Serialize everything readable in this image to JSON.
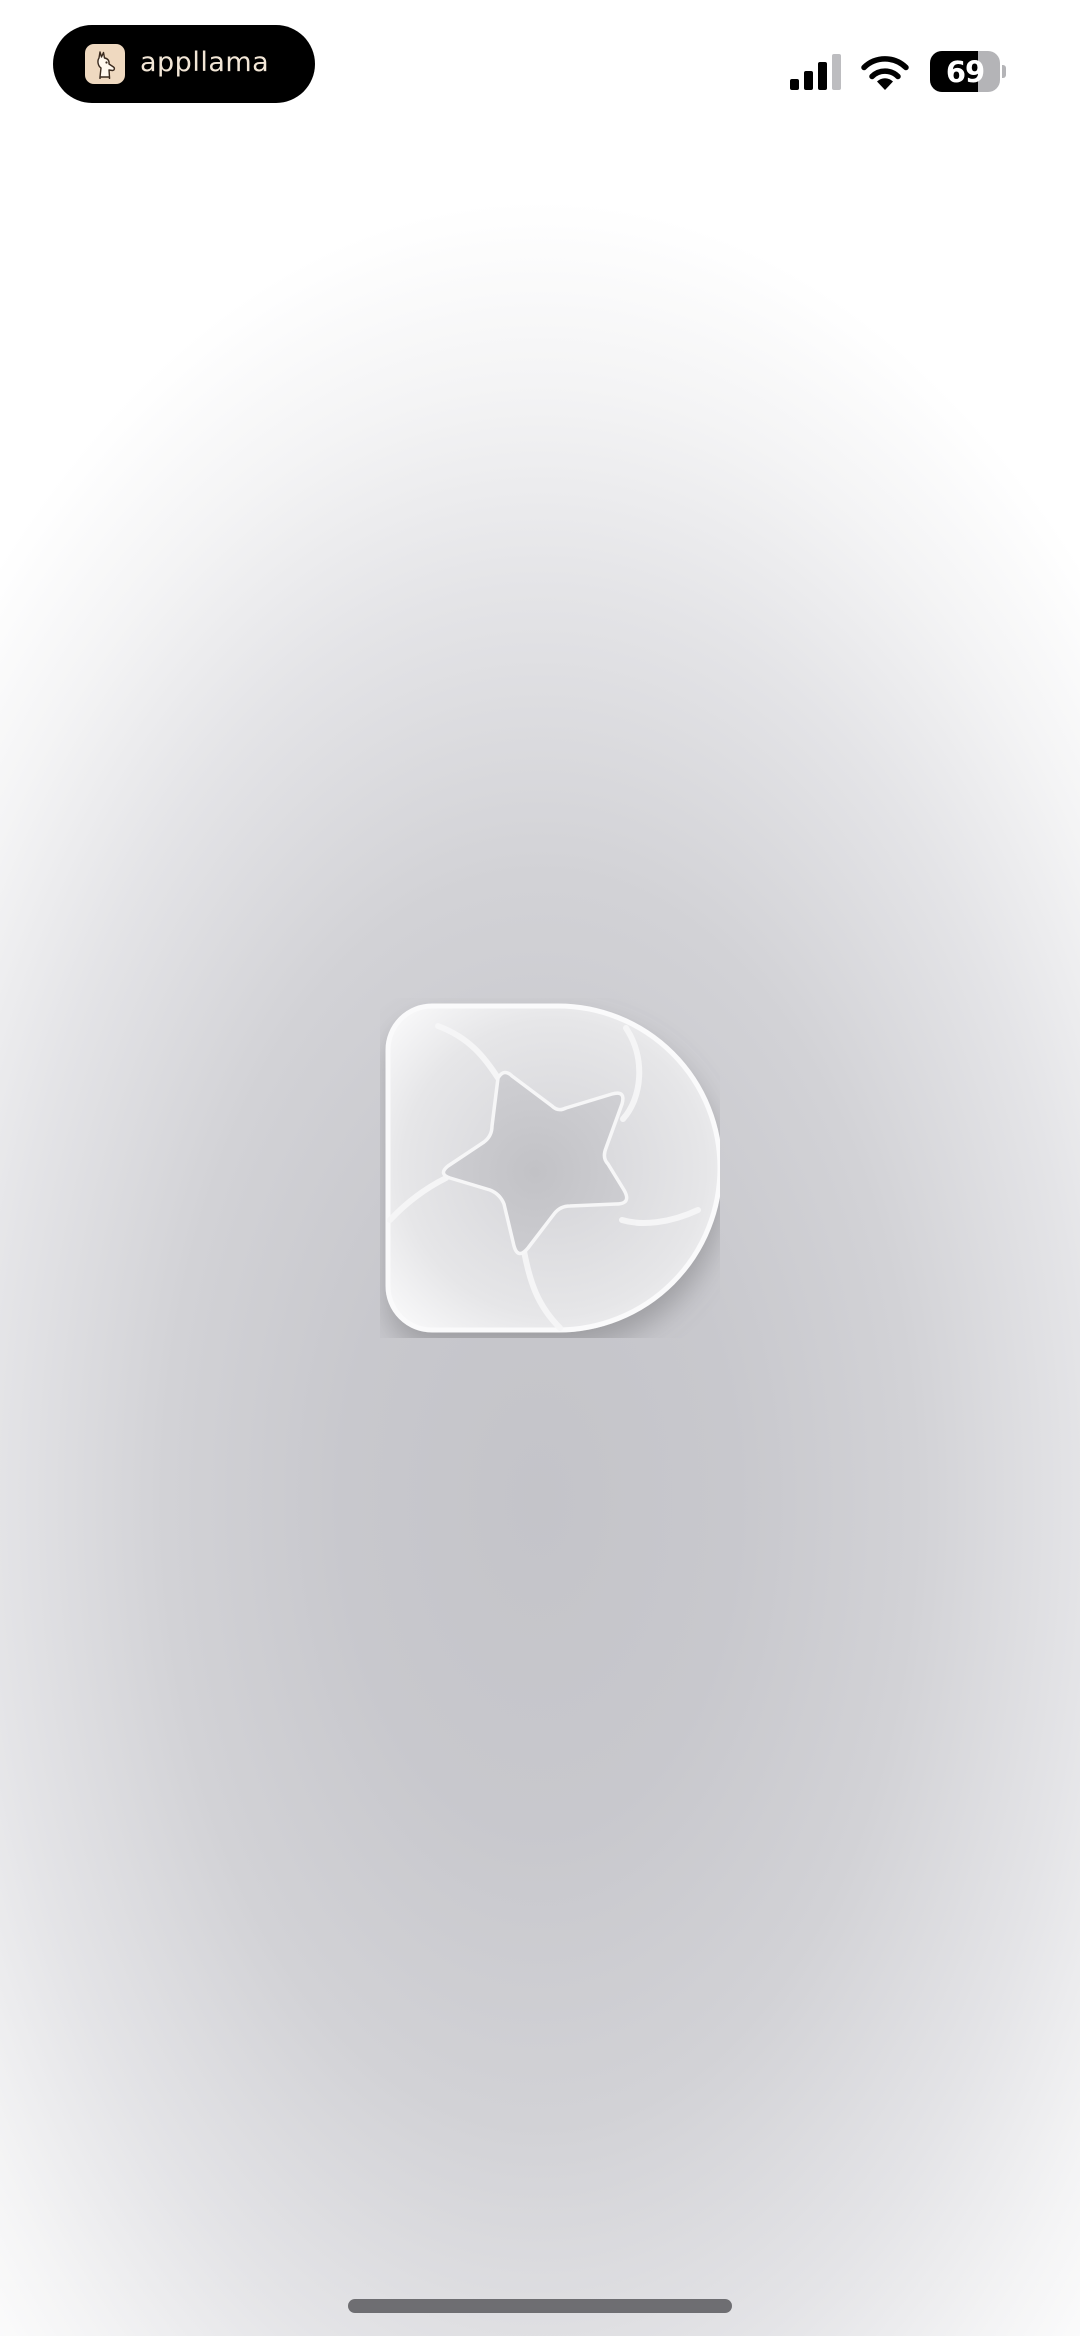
{
  "status_bar": {
    "app_name": "appllama",
    "app_icon": "llama-icon",
    "battery_percent": 69,
    "battery_label": "69",
    "signal_bars": 3,
    "signal_bars_total": 4,
    "wifi": "wifi-icon"
  },
  "splash": {
    "logo_icon": "star-d-logo-icon"
  },
  "colors": {
    "background_center": "#c4c4c9",
    "background_edge": "#ffffff",
    "pill": "#000000",
    "home_indicator": "#6e6e72"
  }
}
